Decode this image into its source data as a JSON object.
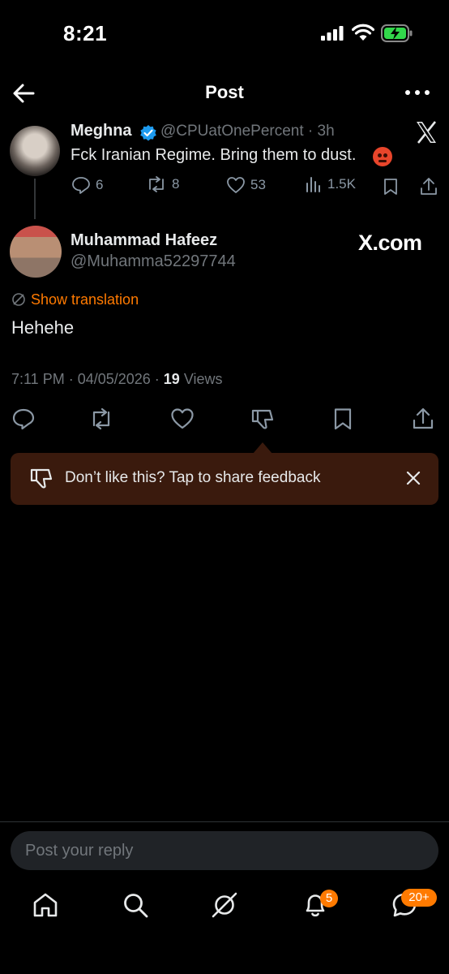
{
  "status_bar": {
    "time": "8:21"
  },
  "header": {
    "title": "Post"
  },
  "quoted_post": {
    "name": "Meghna",
    "handle": "@CPUatOnePercent · 3h",
    "text": "Fck Iranian Regime. Bring them to dust.",
    "replies": "6",
    "reposts": "8",
    "likes": "53",
    "views": "1.5K"
  },
  "main_post": {
    "name": "Muhammad Hafeez",
    "handle": "@Muhamma52297744",
    "watermark": "X.com",
    "translation_label": "Show translation",
    "text": "Hehehe",
    "timestamp": "7:11 PM · 04/05/2026 · ",
    "views_count": "19",
    "views_label": " Views"
  },
  "feedback_banner": {
    "text": "Don’t like this? Tap to share feedback"
  },
  "reply_box": {
    "placeholder": "Post your reply"
  },
  "bottom_nav": {
    "notifications_badge": "5",
    "messages_badge": "20+"
  },
  "colors": {
    "accent": "#ff7a00",
    "banner_bg": "#3a1a0d",
    "verified": "#1d9bf0",
    "muted_text": "#71767b"
  }
}
